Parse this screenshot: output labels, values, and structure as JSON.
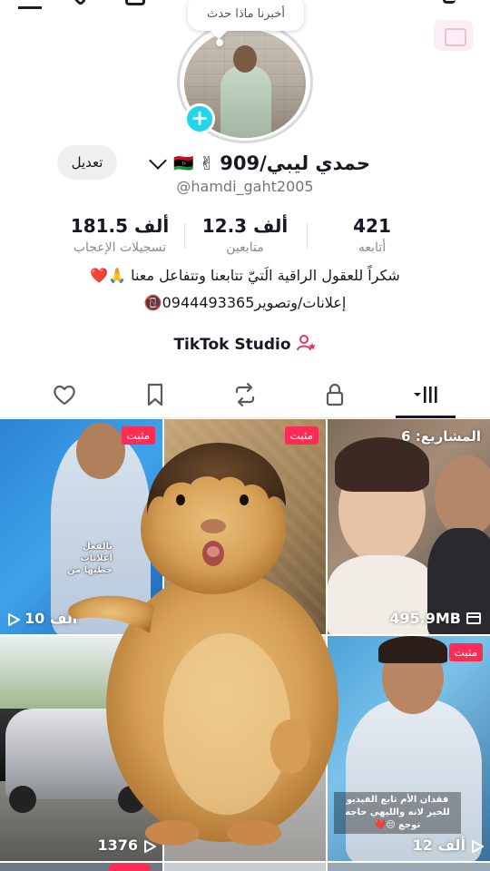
{
  "profile": {
    "note_text": "أخبرنا ماذا حدث",
    "edit_label": "تعديل",
    "display_name": "حمدي ليبي/909",
    "emojis": {
      "peace": "✌",
      "flag": "🇱🇾"
    },
    "handle": "@hamdi_gaht2005",
    "stats": [
      {
        "value": "181.5 ألف",
        "label": "تسجيلات الإعجاب"
      },
      {
        "value": "12.3 ألف",
        "label": "متابعين"
      },
      {
        "value": "421",
        "label": "أتابعه"
      }
    ],
    "bio_line1": "شكراً للعقول الراقية الَتيّ تتابعنا وتتفاعل معنا 🙏❤️",
    "bio_line2": "إعلانات/وتصوير0944493365📵",
    "studio_label": "TikTok Studio"
  },
  "tabs": [
    {
      "icon": "heart-icon"
    },
    {
      "icon": "bookmark-icon"
    },
    {
      "icon": "repost-icon"
    },
    {
      "icon": "lock-icon"
    },
    {
      "icon": "grid-icon",
      "active": true
    }
  ],
  "grid": {
    "pinned_label": "مثبت",
    "cell1": {
      "views": "10 ألف",
      "caption": "بالفعل اعلانات حطيها من"
    },
    "cell3": {
      "projects": "المشاريع: 6",
      "size": "495.9MB"
    },
    "cell4": {
      "views": "1376"
    },
    "cell6": {
      "views": "12 ألف",
      "caption": "فقدان الأم تابع الفيديو للخير لانه والليهي حاجه توجع 😔❤️"
    }
  },
  "colors": {
    "accent": "#fe2c55",
    "add_button": "#20d5ec",
    "text_primary": "#161823",
    "text_secondary": "#8a8b91"
  }
}
